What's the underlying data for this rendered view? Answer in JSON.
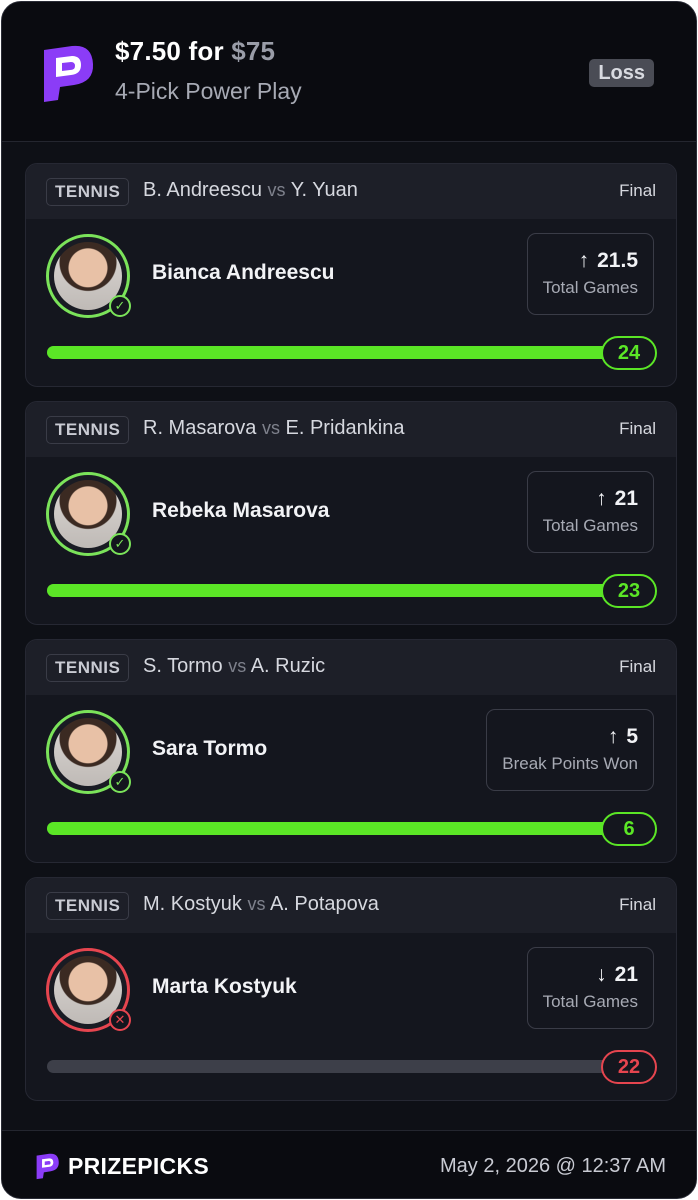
{
  "header": {
    "entry_amount": "$7.50",
    "for_label": "for",
    "payout_amount": "$75",
    "play_type": "4-Pick Power Play",
    "result": "Loss"
  },
  "picks": [
    {
      "sport": "TENNIS",
      "player_short": "B. Andreescu",
      "vs": "vs",
      "opponent_short": "Y. Yuan",
      "status": "Final",
      "player_name": "Bianca Andreescu",
      "direction_icon": "arrow-up-icon",
      "direction_glyph": "↑",
      "line": "21.5",
      "stat_type": "Total Games",
      "final_value": "24",
      "progress": 1.0,
      "result": "won",
      "result_glyph": "✓"
    },
    {
      "sport": "TENNIS",
      "player_short": "R. Masarova",
      "vs": "vs",
      "opponent_short": "E. Pridankina",
      "status": "Final",
      "player_name": "Rebeka Masarova",
      "direction_icon": "arrow-up-icon",
      "direction_glyph": "↑",
      "line": "21",
      "stat_type": "Total Games",
      "final_value": "23",
      "progress": 1.0,
      "result": "won",
      "result_glyph": "✓"
    },
    {
      "sport": "TENNIS",
      "player_short": "S. Tormo",
      "vs": "vs",
      "opponent_short": "A. Ruzic",
      "status": "Final",
      "player_name": "Sara Tormo",
      "direction_icon": "arrow-up-icon",
      "direction_glyph": "↑",
      "line": "5",
      "stat_type": "Break Points Won",
      "final_value": "6",
      "progress": 1.0,
      "result": "won",
      "result_glyph": "✓"
    },
    {
      "sport": "TENNIS",
      "player_short": "M. Kostyuk",
      "vs": "vs",
      "opponent_short": "A. Potapova",
      "status": "Final",
      "player_name": "Marta Kostyuk",
      "direction_icon": "arrow-down-icon",
      "direction_glyph": "↓",
      "line": "21",
      "stat_type": "Total Games",
      "final_value": "22",
      "progress": 0.0,
      "result": "lost",
      "result_glyph": "✕"
    }
  ],
  "footer": {
    "brand": "PRIZEPICKS",
    "datetime": "May 2, 2026 @ 12:37 AM"
  },
  "colors": {
    "brand_purple": "#8b3cf7",
    "win_green": "#5be626",
    "loss_red": "#e6454f",
    "background": "#0e1016"
  }
}
